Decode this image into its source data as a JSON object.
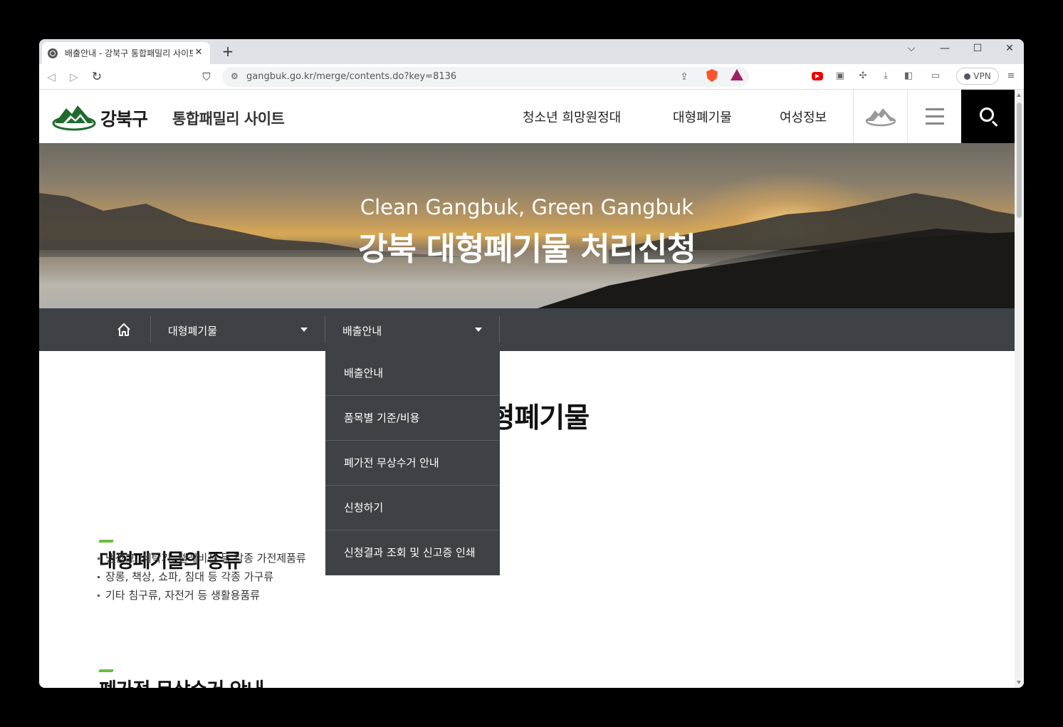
{
  "browser": {
    "tab_title": "배출안내 - 강북구 통합패밀리 사이트",
    "tab_close": "✕",
    "new_tab": "+",
    "url": "gangbuk.go.kr/merge/contents.do?key=8136",
    "vpn_label": "VPN",
    "controls": {
      "chevron": "⌵",
      "minimize": "—",
      "maximize": "☐",
      "close": "✕"
    }
  },
  "site": {
    "logo_text": "강북구",
    "logo_sub": "통합패밀리 사이트",
    "gnb": [
      "청소년 희망원정대",
      "대형폐기물",
      "여성정보"
    ]
  },
  "hero": {
    "slogan_en": "Clean Gangbuk, Green Gangbuk",
    "title_ko": "강북 대형폐기물 처리신청"
  },
  "location": {
    "depth1": "대형폐기물",
    "depth2": "배출안내"
  },
  "dropdown": {
    "items": [
      "배출안내",
      "품목별 기준/비용",
      "폐가전 무상수거 안내",
      "신청하기",
      "신청결과 조회 및 신고증 인쇄"
    ]
  },
  "content": {
    "page_title": "대형폐기물",
    "section1_title": "대형폐기물의 종류",
    "section1_items": [
      "냉장고, 세탁기, 텔레비전 등 각종 가전제품류",
      "장롱, 책상, 쇼파, 침대 등 각종 가구류",
      "기타 침구류, 자전거 등 생활용품류"
    ],
    "section2_title": "폐가전 무상수거 안내"
  },
  "colors": {
    "logo_green": "#1f6b2e",
    "accent_green": "#6bbd3f",
    "locbar_bg": "#3e4145"
  }
}
